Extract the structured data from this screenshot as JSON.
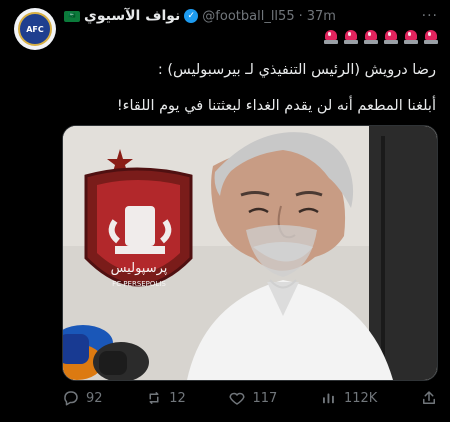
{
  "tweet": {
    "author_name": "نواف الآسيوي",
    "handle": "@football_ll55",
    "separator": "·",
    "time": "37m",
    "more_label": "···",
    "line1": "رضا درويش (الرئيس التنفيذي لـ بيرسبوليس) :",
    "line2": "أبلغنا المطعم أنه لن يقدم الغداء لبعثتنا في يوم اللقاء!"
  },
  "avatar": {
    "text": "AFC"
  },
  "media": {
    "logo_text": "پرسپولیس",
    "club_text": "FC PERSEPOLIS"
  },
  "actions": {
    "replies": "92",
    "reposts": "12",
    "likes": "117",
    "views": "112K"
  },
  "colors": {
    "background": "#000000",
    "text_primary": "#e7e9ea",
    "text_secondary": "#71767b",
    "verified": "#1d9bf0",
    "siren": "#e0245e"
  },
  "icons": [
    "avatar",
    "saudi-flag-icon",
    "verified-badge-icon",
    "more-icon",
    "siren-icon",
    "reply-icon",
    "repost-icon",
    "like-icon",
    "views-icon",
    "share-icon"
  ]
}
